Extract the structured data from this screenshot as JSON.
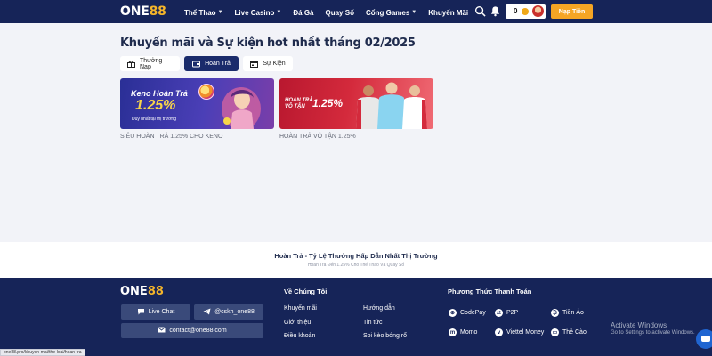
{
  "header": {
    "logo_white": "ONE",
    "logo_yellow": "88",
    "nav": [
      {
        "label": "Thể Thao",
        "has_dropdown": true
      },
      {
        "label": "Live Casino",
        "has_dropdown": true
      },
      {
        "label": "Đá Gà",
        "has_dropdown": false
      },
      {
        "label": "Quay Số",
        "has_dropdown": false
      },
      {
        "label": "Cổng Games",
        "has_dropdown": true
      },
      {
        "label": "Khuyến Mãi",
        "has_dropdown": false
      }
    ],
    "icons": [
      "search-icon",
      "bell-icon"
    ],
    "balance": "0",
    "deposit_label": "Nạp Tiền",
    "colors": {
      "bg": "#162458",
      "accent": "#f5a524"
    }
  },
  "main": {
    "title": "Khuyến mãi và Sự kiện hot nhất tháng 02/2025",
    "tabs": [
      {
        "label": "Thưởng Nạp",
        "icon": "gift-icon",
        "active": false
      },
      {
        "label": "Hoàn Trả",
        "icon": "wallet-icon",
        "active": true
      },
      {
        "label": "Sự Kiện",
        "icon": "calendar-icon",
        "active": false
      }
    ],
    "promos": [
      {
        "banner_title": "Keno Hoàn Trả",
        "banner_value": "1.25%",
        "banner_sub": "Duy nhất tại thị trường",
        "caption": "SIÊU HOÀN TRẢ 1.25% CHO KENO"
      },
      {
        "banner_title_1": "HOÀN TRẢ",
        "banner_title_2": "VÔ TẬN",
        "banner_value": "1.25%",
        "caption": "HOÀN TRẢ VÔ TẬN 1.25%"
      }
    ]
  },
  "info": {
    "title": "Hoàn Trả - Tỷ Lệ Thưởng Hấp Dẫn Nhất Thị Trường",
    "subtitle": "Hoàn Trả Đến 1.25% Cho Thể Thao Và Quay Số"
  },
  "footer": {
    "logo_white": "ONE",
    "logo_yellow": "88",
    "buttons": {
      "live_chat": "Live Chat",
      "telegram": "@cskh_one88",
      "email": "contact@one88.com"
    },
    "about_heading": "Về Chúng Tôi",
    "about_links": [
      "Khuyến mãi",
      "Giới thiệu",
      "Điều khoản",
      "Hướng dẫn",
      "Tin tức",
      "Soi kèo bóng rổ"
    ],
    "payment_heading": "Phương Thức Thanh Toán",
    "payments": [
      "CodePay",
      "P2P",
      "Tiền Ảo",
      "Momo",
      "Viettel Money",
      "Thẻ Cào"
    ]
  },
  "overlay": {
    "activate_title": "Activate Windows",
    "activate_sub": "Go to Settings to activate Windows.",
    "status_url": "one88.pro/khuyen-mai/the-loai/hoan-tra"
  }
}
